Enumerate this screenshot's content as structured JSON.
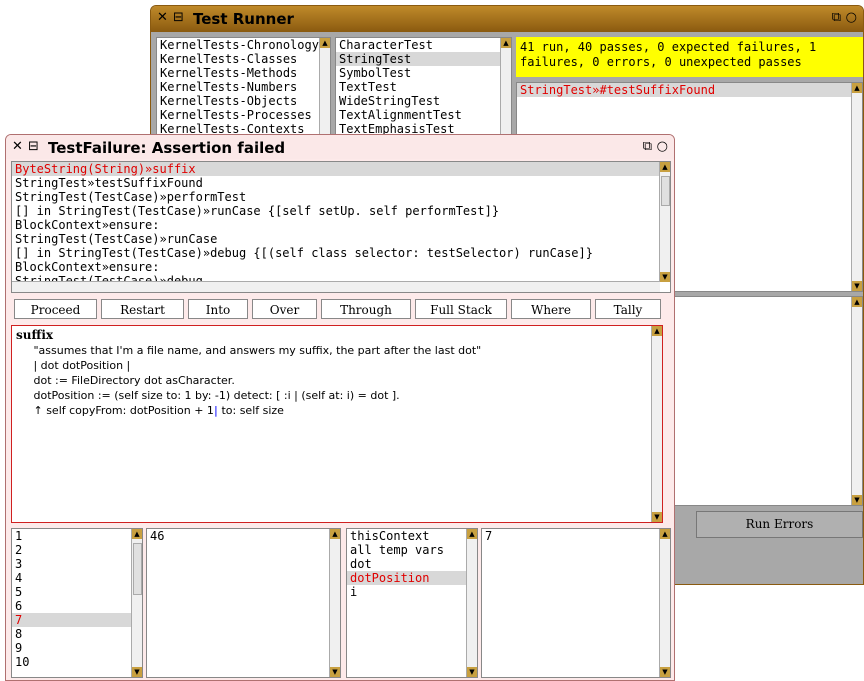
{
  "test_runner": {
    "title": "Test Runner",
    "categories": [
      "KernelTests-Chronology",
      "KernelTests-Classes",
      "KernelTests-Methods",
      "KernelTests-Numbers",
      "KernelTests-Objects",
      "KernelTests-Processes",
      "KernelTests-Contexts"
    ],
    "classes": [
      "CharacterTest",
      "StringTest",
      "SymbolTest",
      "TextTest",
      "WideStringTest",
      "TextAlignmentTest",
      "TextEmphasisTest"
    ],
    "selected_class_index": 1,
    "status": "41 run, 40 passes, 0 expected failures, 1 failures, 0 errors, 0 unexpected passes",
    "failures": [
      "StringTest»#testSuffixFound"
    ],
    "run_errors_label": "Run Errors"
  },
  "test_failure": {
    "title": "TestFailure: Assertion failed",
    "stack": [
      "ByteString(String)»suffix",
      "StringTest»testSuffixFound",
      "StringTest(TestCase)»performTest",
      "[] in StringTest(TestCase)»runCase {[self setUp.  self performTest]}",
      "BlockContext»ensure:",
      "StringTest(TestCase)»runCase",
      "[] in StringTest(TestCase)»debug {[(self class selector: testSelector) runCase]}",
      "BlockContext»ensure:",
      "StringTest(TestCase)»debug"
    ],
    "buttons": [
      "Proceed",
      "Restart",
      "Into",
      "Over",
      "Through",
      "Full Stack",
      "Where",
      "Tally"
    ],
    "code": {
      "selector": "suffix",
      "lines": [
        "     \"assumes that I'm a file name, and answers my suffix, the part after the last dot\"",
        "     | dot dotPosition |",
        "     dot := FileDirectory dot asCharacter.",
        "     dotPosition := (self size to: 1 by: -1) detect: [ :i | (self at: i) = dot ].",
        "     ↑ self copyFrom: dotPosition + 1"
      ],
      "tail": " to: self size"
    },
    "receiver_fields": [
      "1",
      "2",
      "3",
      "4",
      "5",
      "6",
      "7",
      "8",
      "9",
      "10"
    ],
    "receiver_selected": 6,
    "receiver_value": "46",
    "context_fields": [
      "thisContext",
      "all temp vars",
      "dot",
      "dotPosition",
      "i"
    ],
    "context_selected": 3,
    "context_value": "7"
  }
}
